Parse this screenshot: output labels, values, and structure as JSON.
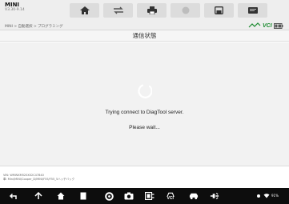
{
  "header": {
    "brand": "MINI",
    "version": "V3.30-9.14",
    "tools": [
      {
        "name": "home-icon"
      },
      {
        "name": "vehicle-swap-icon"
      },
      {
        "name": "print-icon"
      },
      {
        "name": "help-icon"
      },
      {
        "name": "save-icon"
      },
      {
        "name": "data-logging-icon"
      }
    ]
  },
  "breadcrumb": "MINI > 自動選択 > プログラミング",
  "vci": {
    "label": "VCI"
  },
  "section_title": "通信状態",
  "content": {
    "line1": "Trying connect to DiagTool server.",
    "line2": "Please wait..."
  },
  "footer": {
    "vin": "VIN: WMWXM520X02C47840",
    "path": "車: Mini/MINI/Cooper_D/MINI/F55/F55_5ハッチバック"
  },
  "statusbar": {
    "battery": "91%"
  }
}
